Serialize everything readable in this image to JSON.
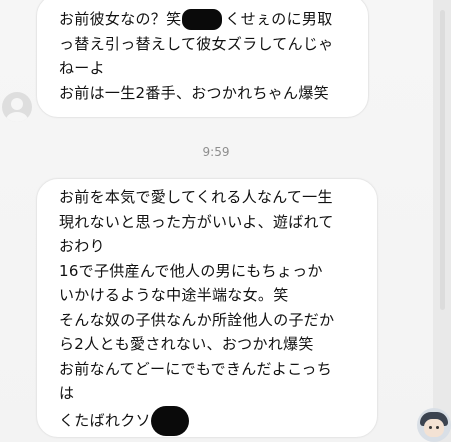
{
  "messages": [
    {
      "lines": [
        {
          "pre": "お前彼女なの？笑",
          "post": "くせぇのに男取"
        },
        {
          "text": "っ替え引っ替えして彼女ズラしてんじゃ"
        },
        {
          "text": "ねーよ"
        },
        {
          "text": "お前は一生2番手、おつかれちゃん爆笑"
        }
      ]
    },
    {
      "lines": [
        {
          "text": "お前を本気で愛してくれる人なんて一生"
        },
        {
          "text": "現れないと思った方がいいよ、遊ばれて"
        },
        {
          "text": "おわり"
        },
        {
          "text": "16で子供産んで他人の男にもちょっか"
        },
        {
          "text": "いかけるような中途半端な女。笑"
        },
        {
          "text": "そんな奴の子供なんか所詮他人の子だか"
        },
        {
          "text": "ら2人とも愛されない、おつかれ爆笑"
        },
        {
          "text": "お前なんてどーにでもできんだよこっち"
        },
        {
          "text": "は"
        },
        {
          "pre": "くたばれクソ",
          "post": ""
        }
      ]
    }
  ],
  "timestamp": "9:59",
  "icons": {
    "sender_avatar": "default-profile-icon",
    "viewer_avatar": "cartoon-boy-avatar-icon"
  },
  "colors": {
    "background": "#f5f5f5",
    "bubble": "#ffffff",
    "bubble_border": "#e7e7e7",
    "text": "#111111",
    "timestamp": "#8e8e8e",
    "redaction": "#0a0a0a"
  }
}
